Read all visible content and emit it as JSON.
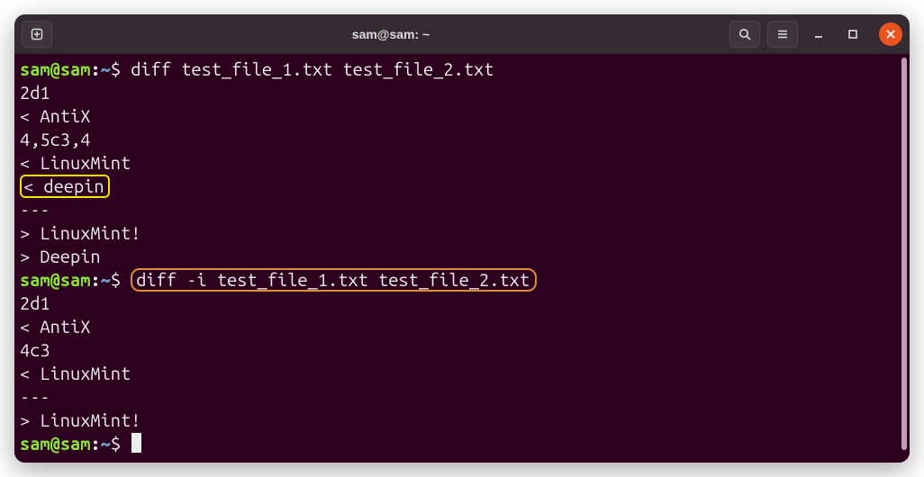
{
  "titlebar": {
    "title": "sam@sam: ~"
  },
  "prompt": {
    "user": "sam",
    "at": "@",
    "host": "sam",
    "colon": ":",
    "path": "~",
    "symbol": "$"
  },
  "block1": {
    "command": "diff test_file_1.txt test_file_2.txt",
    "out1": "2d1",
    "out2": "< AntiX",
    "out3": "4,5c3,4",
    "out4": "< LinuxMint",
    "out5": "< deepin",
    "out6": "---",
    "out7": "> LinuxMint!",
    "out8": "> Deepin"
  },
  "block2": {
    "command": "diff -i test_file_1.txt test_file_2.txt",
    "out1": "2d1",
    "out2": "< AntiX",
    "out3": "4c3",
    "out4": "< LinuxMint",
    "out5": "---",
    "out6": "> LinuxMint!"
  },
  "icons": {
    "newtab": "new-tab-icon",
    "search": "search-icon",
    "menu": "menu-icon",
    "minimize": "minimize-icon",
    "maximize": "maximize-icon",
    "close": "close-icon"
  },
  "colors": {
    "accent": "#e95420",
    "prompt_green": "#8ae234",
    "prompt_blue": "#729fcf",
    "term_bg": "#2c001e",
    "highlight_yellow": "#f5e50a",
    "highlight_orange": "#e08a3c"
  }
}
